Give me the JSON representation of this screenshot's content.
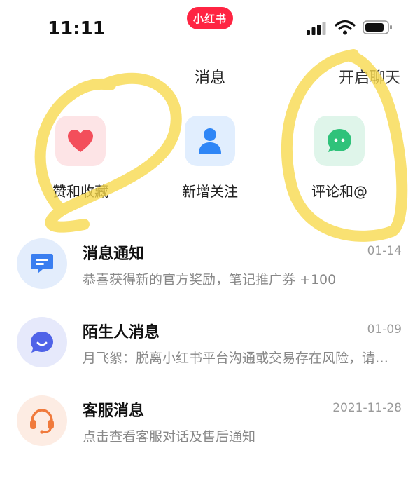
{
  "status_bar": {
    "time": "11:11",
    "app_badge": "小红书",
    "icons": [
      "signal-icon",
      "wifi-icon",
      "battery-icon"
    ]
  },
  "header": {
    "title": "消息",
    "open_chat": "开启聊天"
  },
  "shortcuts": [
    {
      "label": "赞和收藏",
      "icon": "heart-icon",
      "color": "#f34e5b"
    },
    {
      "label": "新增关注",
      "icon": "person-icon",
      "color": "#2f86f6"
    },
    {
      "label": "评论和@",
      "icon": "comment-icon",
      "color": "#2fc27a"
    }
  ],
  "messages": [
    {
      "name": "消息通知",
      "date": "01-14",
      "preview": "恭喜获得新的官方奖励，笔记推广券 +100",
      "icon": "notification-icon",
      "color": "#3a7ef0"
    },
    {
      "name": "陌生人消息",
      "date": "01-09",
      "preview": "月飞絮：脱离小红书平台沟通或交易存在风险，请注意安全",
      "icon": "chat-bubble-icon",
      "color": "#4f63e8"
    },
    {
      "name": "客服消息",
      "date": "2021-11-28",
      "preview": "点击查看客服对话及售后通知",
      "icon": "headset-icon",
      "color": "#f07a3c"
    }
  ],
  "colors": {
    "brand": "#ff2442",
    "highlight": "#f7d84a"
  }
}
